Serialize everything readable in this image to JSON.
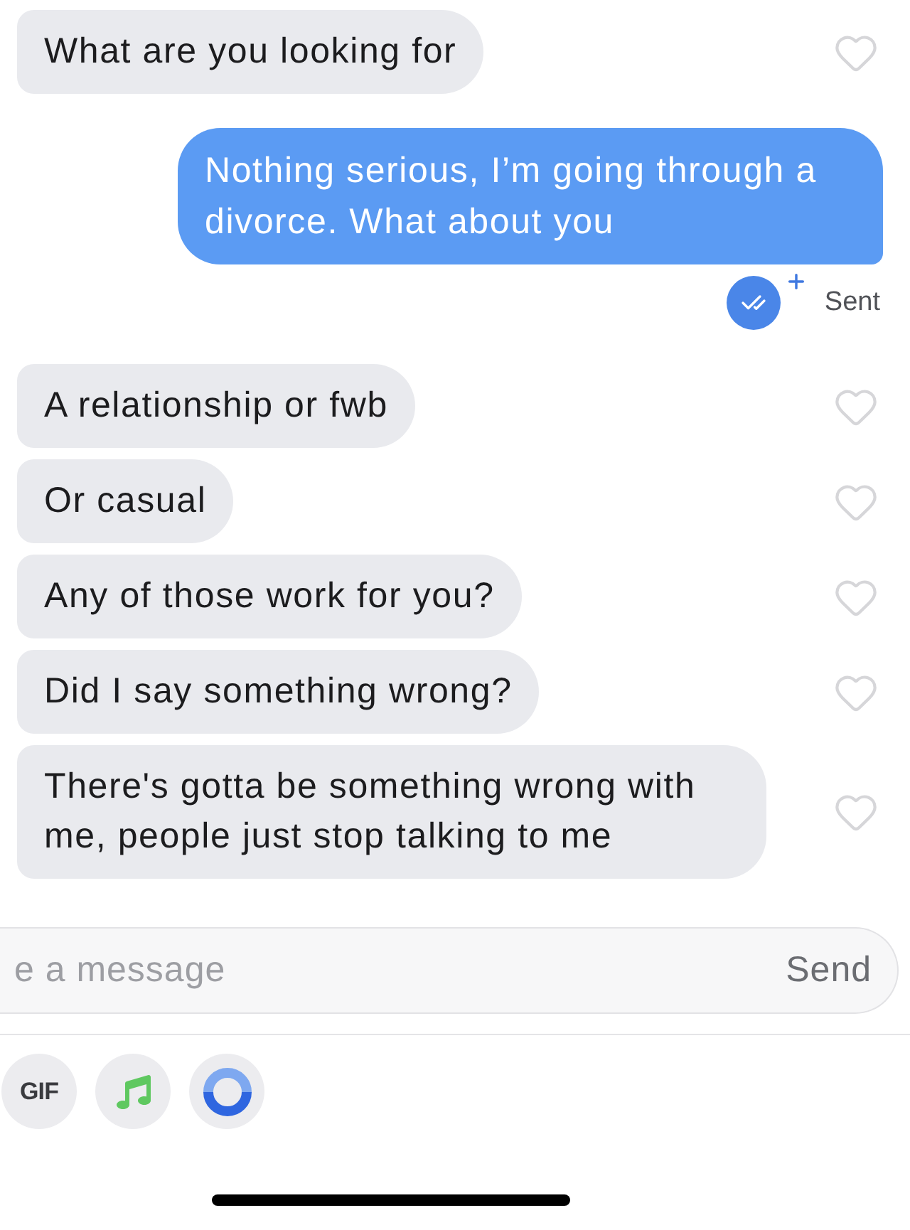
{
  "messages": [
    {
      "kind": "received",
      "text": "What are you looking for",
      "liked": false
    },
    {
      "kind": "sent",
      "text": "Nothing serious, I’m going through a divorce. What about you",
      "status": "Sent"
    },
    {
      "kind": "received",
      "text": "A relationship or fwb",
      "liked": false
    },
    {
      "kind": "received",
      "text": "Or casual",
      "liked": false
    },
    {
      "kind": "received",
      "text": "Any of those work for you?",
      "liked": false
    },
    {
      "kind": "received",
      "text": "Did I say something wrong?",
      "liked": false
    },
    {
      "kind": "received",
      "text": "There's gotta be something wrong with me, people just stop talking to me",
      "liked": false
    }
  ],
  "composer": {
    "placeholder": "e a message",
    "send": "Send"
  },
  "attachments": [
    {
      "kind": "gif",
      "label": "GIF"
    },
    {
      "kind": "music"
    },
    {
      "kind": "loop"
    }
  ]
}
